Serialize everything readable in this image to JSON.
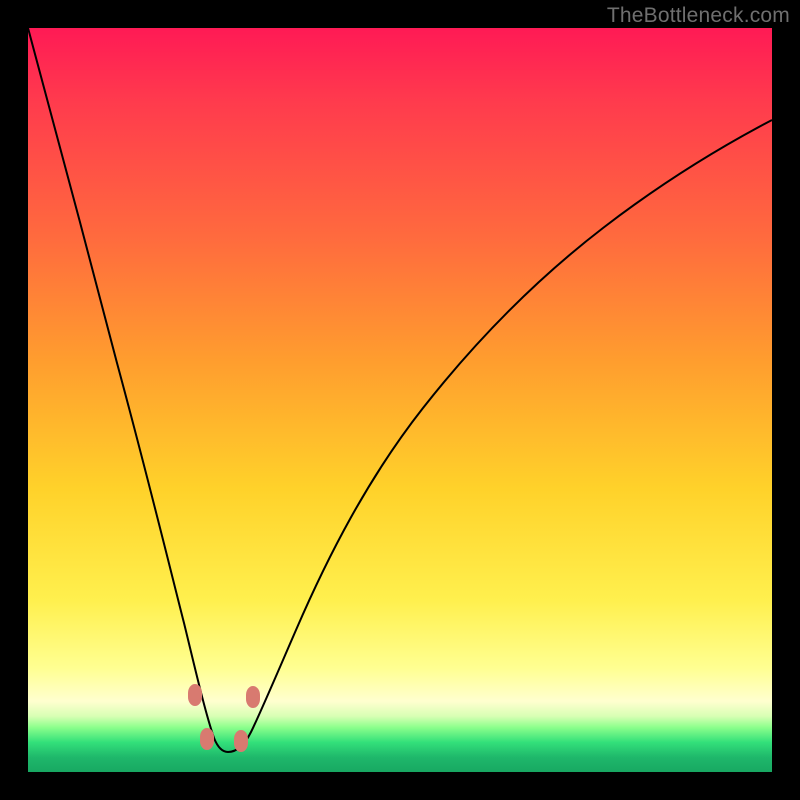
{
  "watermark": "TheBottleneck.com",
  "chart_data": {
    "type": "line",
    "title": "",
    "xlabel": "",
    "ylabel": "",
    "xlim": [
      0,
      100
    ],
    "ylim": [
      0,
      100
    ],
    "curve_description": "V-shaped bottleneck curve with minimum near x≈26; steep left arm, flatter right arm",
    "series": [
      {
        "name": "bottleneck-curve",
        "x": [
          0,
          4,
          8,
          12,
          16,
          19,
          21,
          22.5,
          24,
          25.5,
          26.8,
          28,
          29.5,
          31,
          34,
          38,
          44,
          52,
          62,
          74,
          88,
          100
        ],
        "y": [
          100,
          85,
          70,
          55,
          40,
          28,
          20,
          14,
          9,
          5,
          3.5,
          3.5,
          5,
          8,
          15,
          24,
          36,
          49,
          61,
          72,
          82,
          88
        ]
      }
    ],
    "markers": [
      {
        "x": 22.4,
        "y": 10.2
      },
      {
        "x": 23.8,
        "y": 4.4
      },
      {
        "x": 29.1,
        "y": 4.3
      },
      {
        "x": 30.8,
        "y": 10.0
      }
    ],
    "gradient_meaning": "color indicates bottleneck severity from green (good, bottom) to red (bad, top)"
  }
}
